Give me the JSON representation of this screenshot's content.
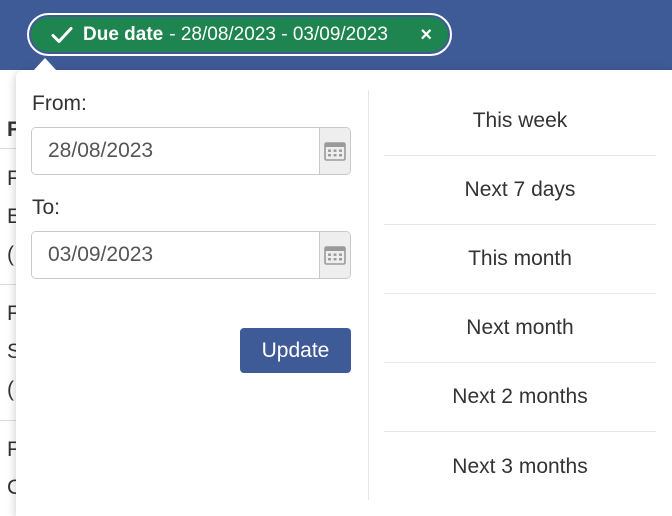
{
  "filter_chip": {
    "label": "Due date",
    "range": "- 28/08/2023 - 03/09/2023",
    "close_symbol": "×",
    "icon": "check-icon",
    "color": "#1f8550"
  },
  "background": {
    "header_color": "#3f5b97",
    "peek_chars": [
      "F",
      "F",
      "E",
      "(",
      "F",
      "S",
      "(",
      "F",
      "C"
    ]
  },
  "date_picker": {
    "from_label": "From:",
    "from_value": "28/08/2023",
    "to_label": "To:",
    "to_value": "03/09/2023",
    "calendar_icon": "calendar-icon",
    "update_label": "Update"
  },
  "presets": [
    "This week",
    "Next 7 days",
    "This month",
    "Next month",
    "Next 2 months",
    "Next 3 months"
  ],
  "colors": {
    "accent": "#3f5b97",
    "chip": "#1f8550"
  }
}
